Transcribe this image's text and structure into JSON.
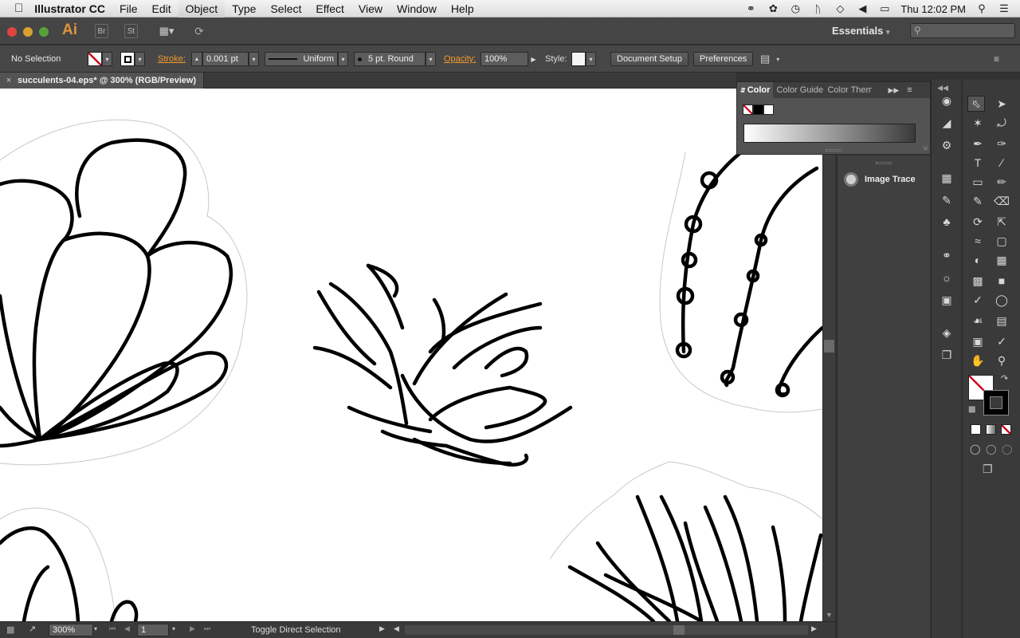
{
  "menubar": {
    "app_name": "Illustrator CC",
    "menus": [
      "File",
      "Edit",
      "Object",
      "Type",
      "Select",
      "Effect",
      "View",
      "Window",
      "Help"
    ],
    "clock": "Thu 12:02 PM"
  },
  "appbar": {
    "logo": "Ai",
    "bridge": "Br",
    "stock": "St",
    "workspace": "Essentials"
  },
  "control": {
    "selection": "No Selection",
    "stroke_label": "Stroke:",
    "stroke_weight": "0.001 pt",
    "profile": "Uniform",
    "brush": "5 pt. Round",
    "opacity_label": "Opacity:",
    "opacity": "100%",
    "style_label": "Style:",
    "document_setup": "Document Setup",
    "preferences": "Preferences"
  },
  "document": {
    "tab_title": "succulents-04.eps* @ 300% (RGB/Preview)"
  },
  "status": {
    "zoom": "300%",
    "artboard": "1",
    "tool_hint": "Toggle Direct Selection"
  },
  "panels": {
    "color_tabs": [
      "Color",
      "Color Guide",
      "Color Themes"
    ],
    "image_trace": "Image Trace"
  },
  "colors": {
    "accent_orange": "#f29b2b",
    "panel_dark": "#3a3a3a",
    "panel_mid": "#535353",
    "none_swatch_red": "#d0021b"
  }
}
